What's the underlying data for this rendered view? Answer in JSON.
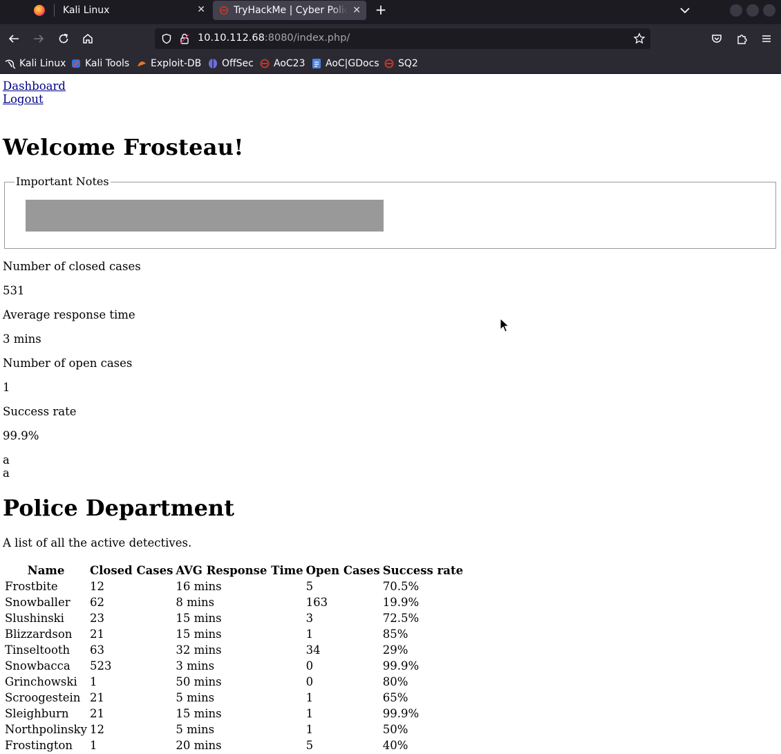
{
  "browser": {
    "tabs": [
      {
        "title": "Kali Linux"
      },
      {
        "title": "TryHackMe | Cyber Police"
      }
    ],
    "url_host": "10.10.112.68",
    "url_rest": ":8080/index.php/",
    "bookmarks": [
      {
        "label": "Kali Linux",
        "icon": "kali-dragon-icon"
      },
      {
        "label": "Kali Tools",
        "icon": "kali-tools-icon"
      },
      {
        "label": "Exploit-DB",
        "icon": "exploit-db-icon"
      },
      {
        "label": "OffSec",
        "icon": "offsec-icon"
      },
      {
        "label": "AoC23",
        "icon": "aoc-icon"
      },
      {
        "label": "AoC|GDocs",
        "icon": "gdocs-icon"
      },
      {
        "label": "SQ2",
        "icon": "sq2-icon"
      }
    ]
  },
  "page": {
    "links": {
      "dashboard": "Dashboard",
      "logout": "Logout"
    },
    "welcome": "Welcome Frosteau!",
    "notes_legend": "Important Notes",
    "stats": [
      {
        "label": "Number of closed cases",
        "value": "531"
      },
      {
        "label": "Average response time",
        "value": "3 mins"
      },
      {
        "label": "Number of open cases",
        "value": "1"
      },
      {
        "label": "Success rate",
        "value": "99.9%"
      }
    ],
    "stray_lines": [
      "a",
      "a"
    ],
    "department_title": "Police Department",
    "department_desc": "A list of all the active detectives.",
    "table": {
      "headers": [
        "Name",
        "Closed Cases",
        "AVG Response Time",
        "Open Cases",
        "Success rate"
      ],
      "rows": [
        [
          "Frostbite",
          "12",
          "16 mins",
          "5",
          "70.5%"
        ],
        [
          "Snowballer",
          "62",
          "8 mins",
          "163",
          "19.9%"
        ],
        [
          "Slushinski",
          "23",
          "15 mins",
          "3",
          "72.5%"
        ],
        [
          "Blizzardson",
          "21",
          "15 mins",
          "1",
          "85%"
        ],
        [
          "Tinseltooth",
          "63",
          "32 mins",
          "34",
          "29%"
        ],
        [
          "Snowbacca",
          "523",
          "3 mins",
          "0",
          "99.9%"
        ],
        [
          "Grinchowski",
          "1",
          "50 mins",
          "0",
          "80%"
        ],
        [
          "Scroogestein",
          "21",
          "5 mins",
          "1",
          "65%"
        ],
        [
          "Sleighburn",
          "21",
          "15 mins",
          "1",
          "99.9%"
        ],
        [
          "Northpolinsky",
          "12",
          "5 mins",
          "1",
          "50%"
        ],
        [
          "Frostington",
          "1",
          "20 mins",
          "5",
          "40%"
        ]
      ]
    }
  },
  "colors": {
    "chrome_dark": "#1c1b22",
    "chrome_toolbar": "#2b2a33",
    "active_tab": "#42414d",
    "redacted_box": "#999999"
  }
}
